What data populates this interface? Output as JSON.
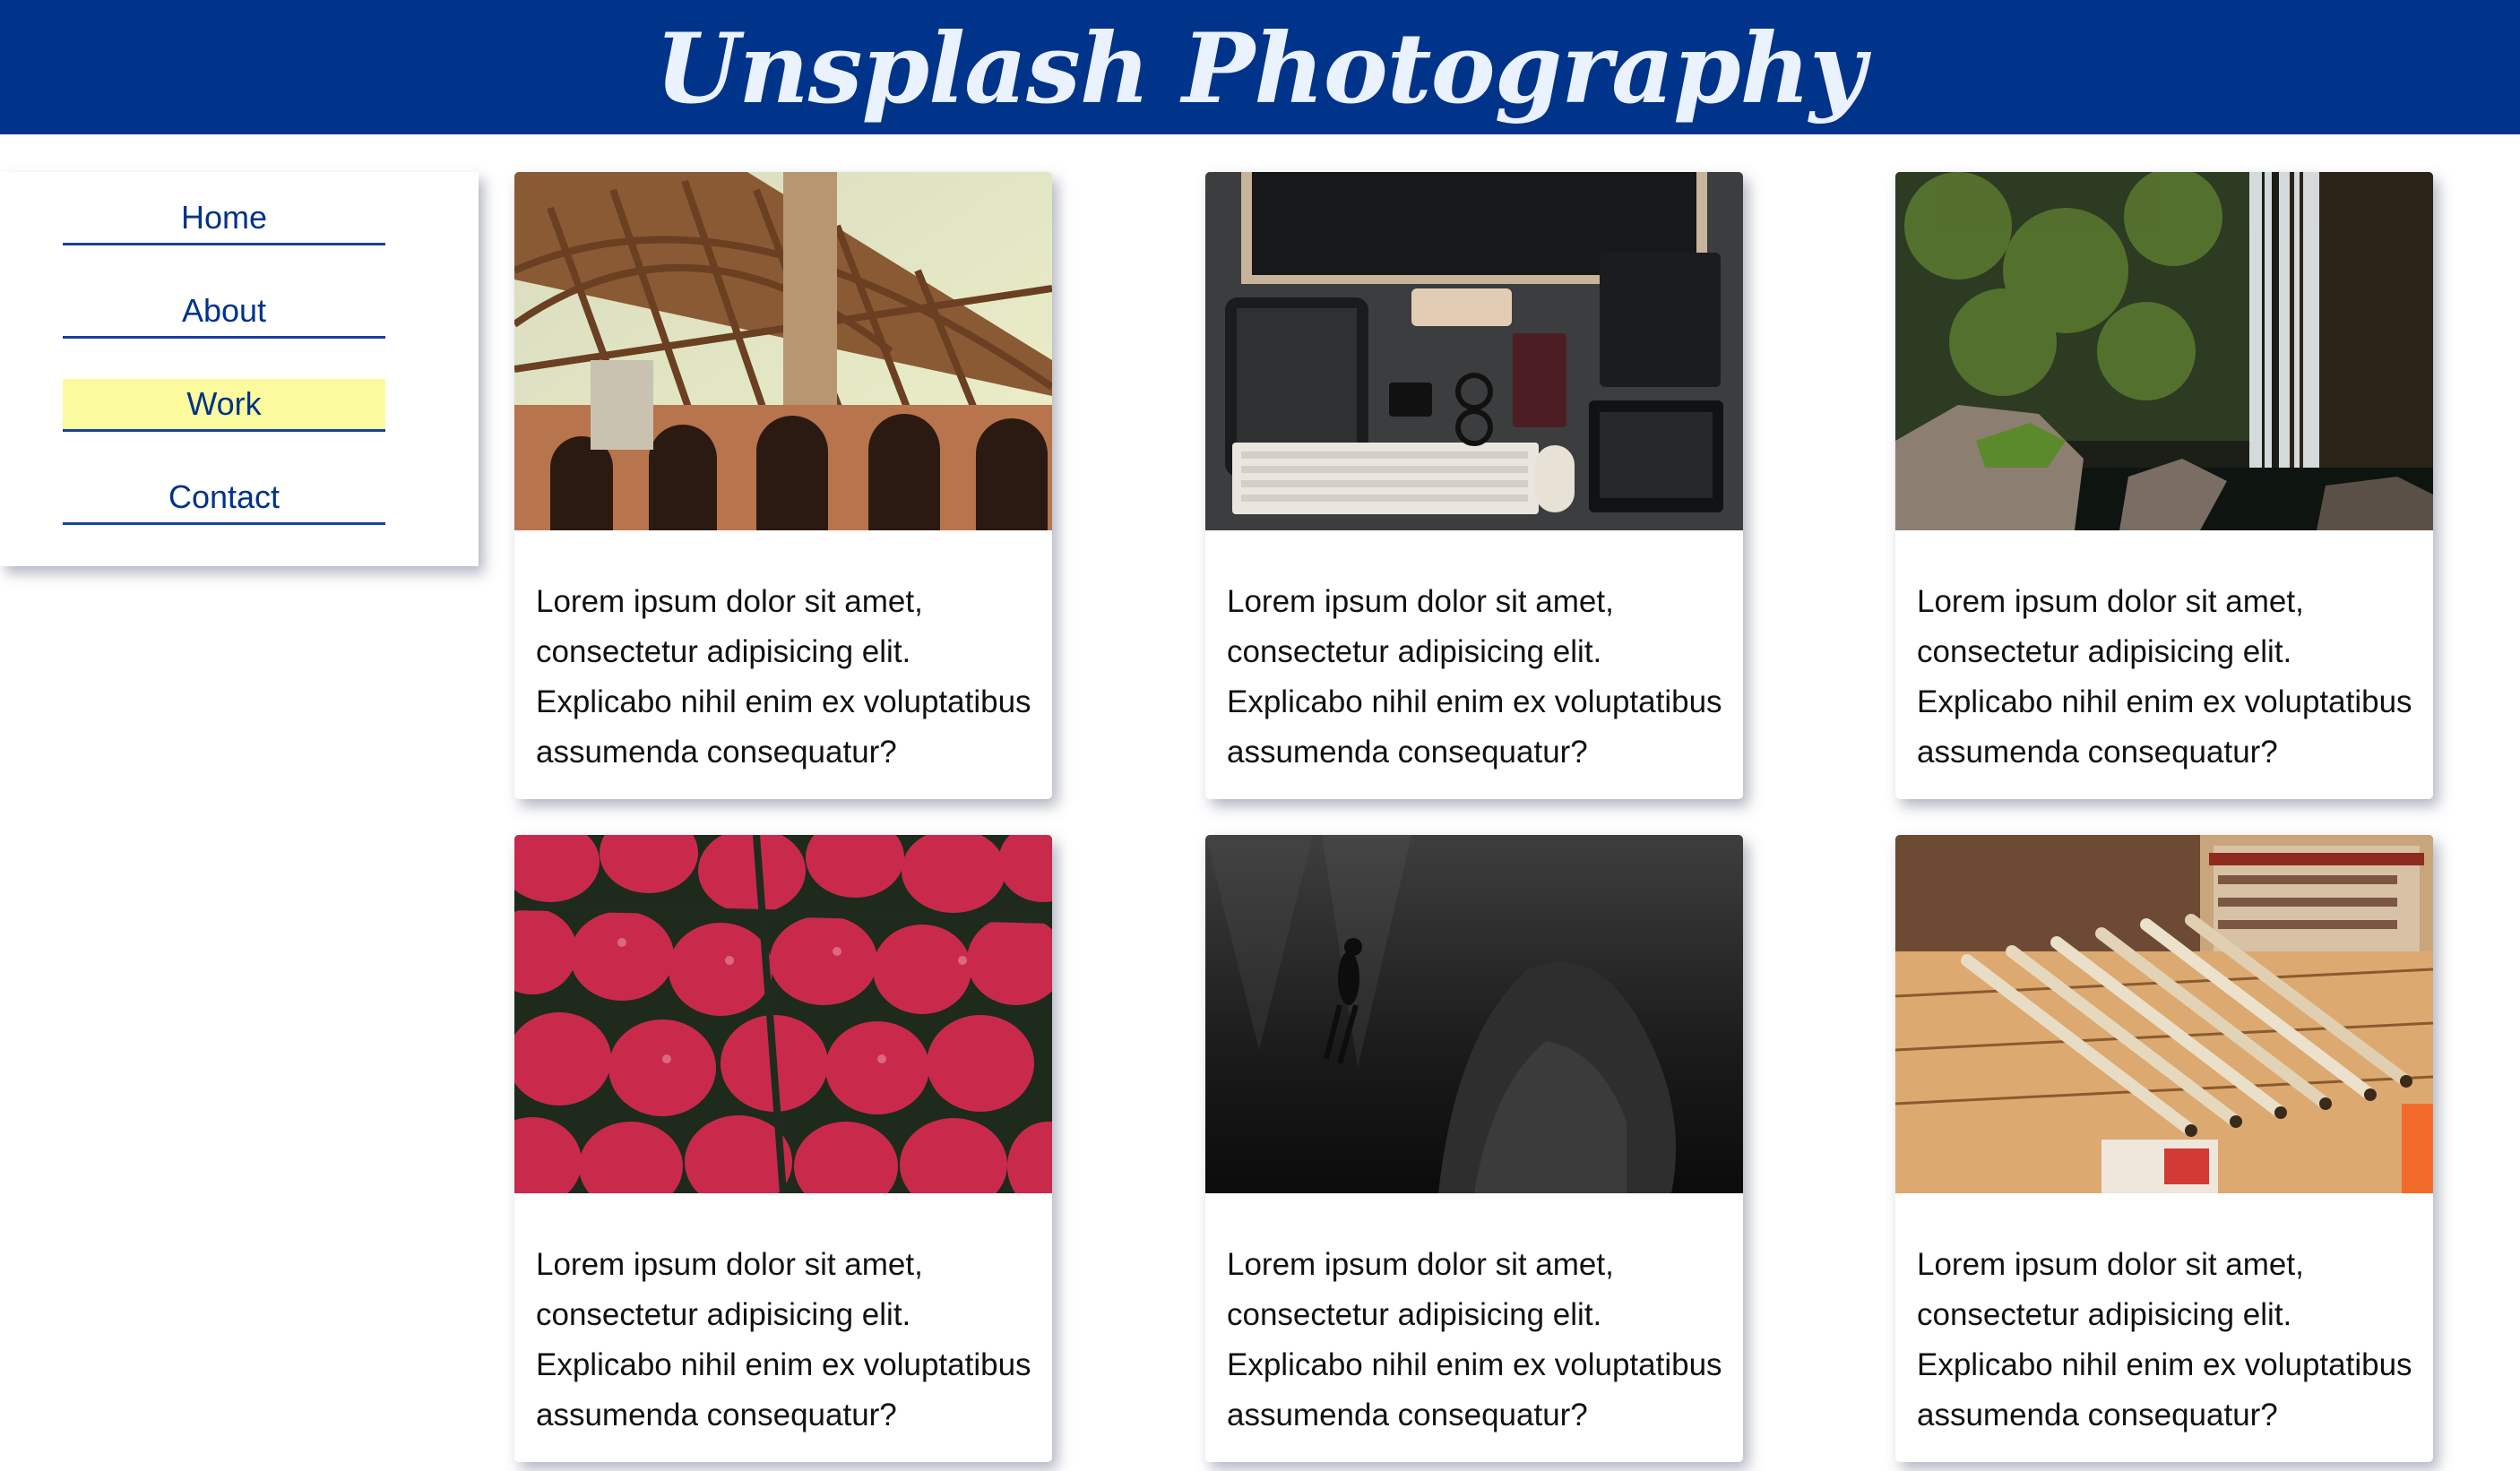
{
  "header": {
    "title": "Unsplash Photography"
  },
  "nav": {
    "items": [
      {
        "label": "Home",
        "active": false
      },
      {
        "label": "About",
        "active": false
      },
      {
        "label": "Work",
        "active": true
      },
      {
        "label": "Contact",
        "active": false
      }
    ]
  },
  "cards": [
    {
      "text": "Lorem ipsum dolor sit amet, consectetur adipisicing elit. Explicabo nihil enim ex voluptatibus assumenda consequatur?"
    },
    {
      "text": "Lorem ipsum dolor sit amet, consectetur adipisicing elit. Explicabo nihil enim ex voluptatibus assumenda consequatur?"
    },
    {
      "text": "Lorem ipsum dolor sit amet, consectetur adipisicing elit. Explicabo nihil enim ex voluptatibus assumenda consequatur?"
    },
    {
      "text": "Lorem ipsum dolor sit amet, consectetur adipisicing elit. Explicabo nihil enim ex voluptatibus assumenda consequatur?"
    },
    {
      "text": "Lorem ipsum dolor sit amet, consectetur adipisicing elit. Explicabo nihil enim ex voluptatibus assumenda consequatur?"
    },
    {
      "text": "Lorem ipsum dolor sit amet, consectetur adipisicing elit. Explicabo nihil enim ex voluptatibus assumenda consequatur?"
    }
  ],
  "colors": {
    "header_bg": "#00338a",
    "title_color": "#eaf1ff",
    "nav_text": "#00338a",
    "nav_underline": "#1a3f9a",
    "active_highlight": "#fbfb9d"
  }
}
